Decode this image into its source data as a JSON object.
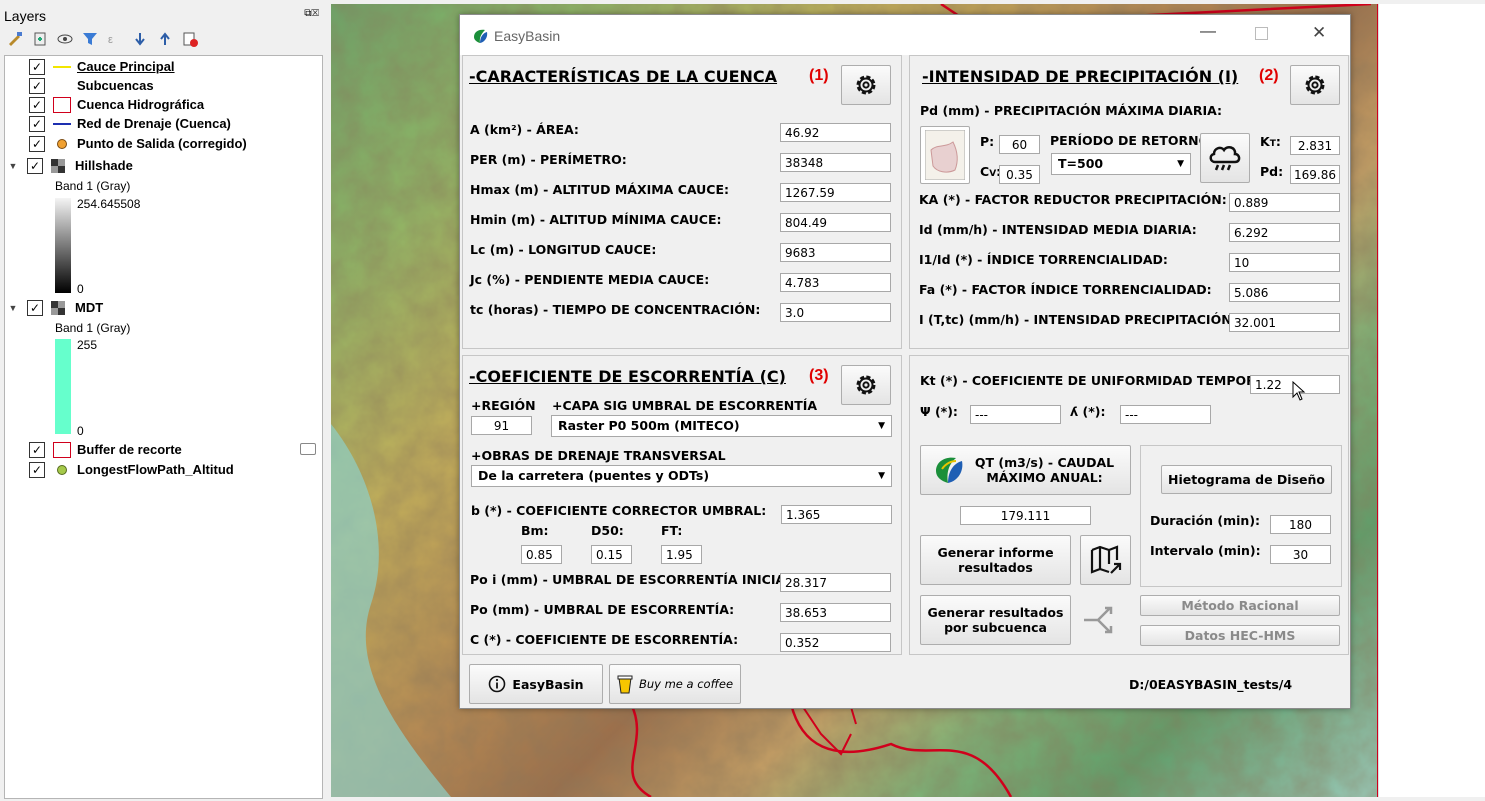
{
  "layers_panel": {
    "title": "Layers",
    "items": [
      {
        "label": "Cauce Principal",
        "checked": "✓",
        "underline": true
      },
      {
        "label": "Subcuencas",
        "checked": "✓"
      },
      {
        "label": "Cuenca Hidrográfica",
        "checked": "✓"
      },
      {
        "label": "Red de Drenaje (Cuenca)",
        "checked": "✓"
      },
      {
        "label": "Punto de Salida (corregido)",
        "checked": "✓"
      },
      {
        "label": "Hillshade",
        "checked": "✓"
      },
      {
        "label": "Band 1 (Gray)"
      },
      {
        "label": "254.645508"
      },
      {
        "label": "0"
      },
      {
        "label": "MDT",
        "checked": "✓"
      },
      {
        "label": "Band 1 (Gray)"
      },
      {
        "label": "255"
      },
      {
        "label": "0"
      },
      {
        "label": "Buffer de recorte",
        "checked": "✓"
      },
      {
        "label": "LongestFlowPath_Altitud",
        "checked": "✓"
      }
    ]
  },
  "dialog": {
    "title": "EasyBasin",
    "section1": {
      "heading": "-CARACTERÍSTICAS DE LA CUENCA",
      "number": "(1)",
      "rows": [
        {
          "label": "A (km²) - ÁREA:",
          "value": "46.92"
        },
        {
          "label": "PER (m) - PERÍMETRO:",
          "value": "38348"
        },
        {
          "label": "Hmax (m) - ALTITUD MÁXIMA CAUCE:",
          "value": "1267.59"
        },
        {
          "label": "Hmin (m) - ALTITUD MÍNIMA CAUCE:",
          "value": "804.49"
        },
        {
          "label": "Lc (m) - LONGITUD CAUCE:",
          "value": "9683"
        },
        {
          "label": "Jc (%) - PENDIENTE MEDIA CAUCE:",
          "value": "4.783"
        },
        {
          "label": "tc (horas) - TIEMPO DE CONCENTRACIÓN:",
          "value": "3.0"
        }
      ]
    },
    "section2": {
      "heading": "-INTENSIDAD DE PRECIPITACIÓN (I)",
      "number": "(2)",
      "pd_label": "Pd (mm) - PRECIPITACIÓN MÁXIMA DIARIA:",
      "p_label": "P:",
      "p_value": "60",
      "cv_label": "C",
      "cv_sub": "V",
      "cv_suffix": ":",
      "cv_value": "0.35",
      "return_label": "PERÍODO DE RETORNO:",
      "return_value": "T=500",
      "kt_label": "K",
      "kt_sub": "T",
      "kt_suffix": ":",
      "kt_value": "2.831",
      "pd_short": "Pd:",
      "pd_value": "169.86",
      "rows": [
        {
          "label": "KA (*) - FACTOR REDUCTOR PRECIPITACIÓN:",
          "value": "0.889"
        },
        {
          "label": "Id (mm/h) - INTENSIDAD MEDIA DIARIA:",
          "value": "6.292"
        },
        {
          "label": "I1/Id (*) - ÍNDICE TORRENCIALIDAD:",
          "value": "10"
        },
        {
          "label": "Fa (*) - FACTOR ÍNDICE TORRENCIALIDAD:",
          "value": "5.086"
        },
        {
          "label": "I (T,tc) (mm/h) - INTENSIDAD PRECIPITACIÓN:",
          "value": "32.001"
        }
      ]
    },
    "section3": {
      "heading": "-COEFICIENTE DE ESCORRENTÍA (C)",
      "number": "(3)",
      "region_label": "+REGIÓN",
      "region_value": "91",
      "capa_label": "+CAPA SIG UMBRAL DE ESCORRENTÍA",
      "capa_value": "Raster P0 500m (MITECO)",
      "obras_label": "+OBRAS DE DRENAJE TRANSVERSAL",
      "obras_value": "De la carretera (puentes y ODTs)",
      "b_label": "b (*) - COEFICIENTE CORRECTOR UMBRAL:",
      "b_value": "1.365",
      "bm_label": "Bm:",
      "bm_value": "0.85",
      "d50_label": "D50:",
      "d50_value": "0.15",
      "ft_label": "FT:",
      "ft_value": "1.95",
      "rows": [
        {
          "label": "Po i (mm) - UMBRAL DE ESCORRENTÍA INICIAL:",
          "value": "28.317"
        },
        {
          "label": "Po (mm) - UMBRAL DE ESCORRENTÍA:",
          "value": "38.653"
        },
        {
          "label": "C (*) - COEFICIENTE DE ESCORRENTÍA:",
          "value": "0.352"
        }
      ]
    },
    "section4": {
      "kt_label": "Kt (*) - COEFICIENTE DE UNIFORMIDAD TEMPORAL:",
      "kt_value": "1.22",
      "psi_label": "Ψ (*):",
      "psi_value": "---",
      "lambda_label": "ʎ (*):",
      "lambda_value": "---",
      "qt_button": "QT (m3/s) - CAUDAL MÁXIMO ANUAL:",
      "qt_value": "179.111",
      "informe_button": "Generar informe resultados",
      "hietograma_button": "Hietograma de Diseño",
      "duracion_label": "Duración (min):",
      "duracion_value": "180",
      "intervalo_label": "Intervalo (min):",
      "intervalo_value": "30",
      "subcuenca_button": "Generar resultados por subcuenca",
      "racional_button": "Método Racional",
      "hec_button": "Datos HEC-HMS"
    },
    "footer": {
      "easybasin_button": "EasyBasin",
      "coffee_button": "Buy me a coffee",
      "path": "D:/0EASYBASIN_tests/4"
    }
  },
  "colors": {
    "accent_red": "#e00000",
    "map_boundary": "#d0001c"
  }
}
